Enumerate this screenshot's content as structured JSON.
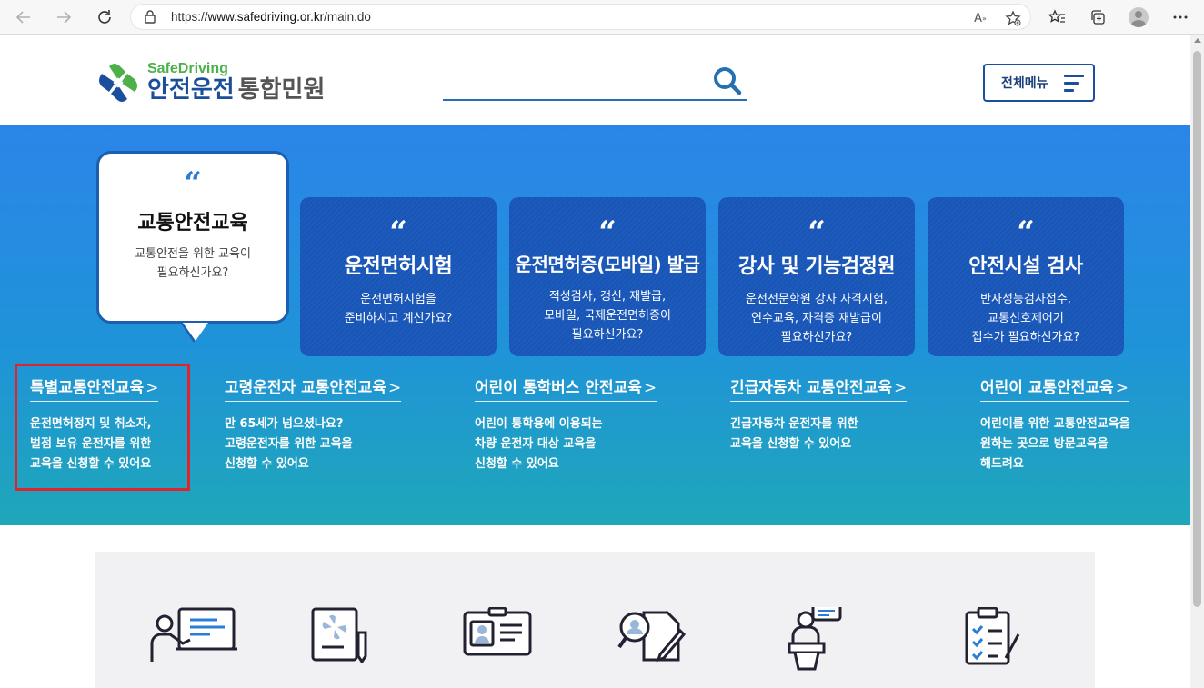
{
  "browser": {
    "url_prefix": "https://",
    "url_host": "www.safedriving.or.kr",
    "url_path": "/main.do"
  },
  "header": {
    "logo_en": "SafeDriving",
    "logo_ko_main": "안전운전",
    "logo_ko_sub": "통합민원",
    "menu_label": "전체메뉴"
  },
  "featured": {
    "title": "교통안전교육",
    "desc_line1": "교통안전을 위한 교육이",
    "desc_line2": "필요하신가요?"
  },
  "cards": [
    {
      "title": "운전면허시험",
      "desc_line1": "운전면허시험을",
      "desc_line2": "준비하시고 계신가요?",
      "desc_line3": ""
    },
    {
      "title": "운전면허증(모바일) 발급",
      "desc_line1": "적성검사, 갱신, 재발급,",
      "desc_line2": "모바일, 국제운전면허증이",
      "desc_line3": "필요하신가요?"
    },
    {
      "title": "강사 및 기능검정원",
      "desc_line1": "운전전문학원 강사 자격시험,",
      "desc_line2": "연수교육, 자격증 재발급이",
      "desc_line3": "필요하신가요?"
    },
    {
      "title": "안전시설 검사",
      "desc_line1": "반사성능검사접수,",
      "desc_line2": "교통신호제어기",
      "desc_line3": "접수가 필요하신가요?"
    }
  ],
  "edu_links": [
    {
      "title": "특별교통안전교육",
      "desc_line1": "운전면허정지 및 취소자,",
      "desc_line2": "벌점 보유 운전자를 위한",
      "desc_line3": "교육을 신청할 수 있어요"
    },
    {
      "title": "고령운전자 교통안전교육",
      "desc_line1": "만 65세가 넘으셨나요?",
      "desc_line2": "고령운전자를 위한 교육을",
      "desc_line3": "신청할 수 있어요"
    },
    {
      "title": "어린이 통학버스 안전교육",
      "desc_line1": "어린이 통학용에 이용되는",
      "desc_line2": "차량 운전자 대상 교육을",
      "desc_line3": "신청할 수 있어요"
    },
    {
      "title": "긴급자동차 교통안전교육",
      "desc_line1": "긴급자동차 운전자를 위한",
      "desc_line2": "교육을 신청할 수 있어요",
      "desc_line3": ""
    },
    {
      "title": "어린이 교통안전교육",
      "desc_line1": "어린이를 위한 교통안전교육을",
      "desc_line2": "원하는 곳으로 방문교육을",
      "desc_line3": "해드려요"
    }
  ],
  "chevron": ">",
  "quote_mark": "“",
  "services": [
    {
      "icon": "lecture-icon"
    },
    {
      "icon": "document-pen-icon"
    },
    {
      "icon": "id-card-icon"
    },
    {
      "icon": "search-document-icon"
    },
    {
      "icon": "speaker-podium-icon"
    },
    {
      "icon": "checklist-icon"
    }
  ],
  "colors": {
    "brand_blue": "#1b4f9c",
    "brand_green": "#4db04a",
    "hero_top": "#2b85e8",
    "hero_bottom": "#1fa7b9",
    "highlight_red": "#e0242d"
  }
}
